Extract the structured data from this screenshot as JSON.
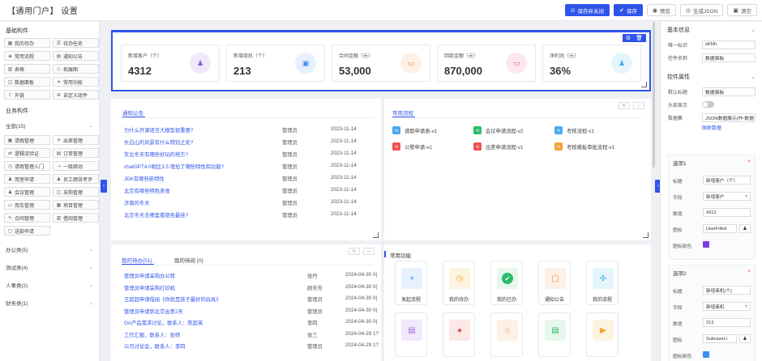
{
  "header": {
    "title": "【通用门户】 设置",
    "buttons": [
      {
        "label": "保存并关闭",
        "icon": "save-close-icon"
      },
      {
        "label": "保存",
        "icon": "save-icon"
      },
      {
        "label": "预览",
        "icon": "eye-icon"
      },
      {
        "label": "生成JSON",
        "icon": "code-icon"
      },
      {
        "label": "清空",
        "icon": "trash-icon"
      }
    ]
  },
  "left": {
    "basic_title": "基础构件",
    "basic": [
      "我的待办",
      "待办任务",
      "常用流程",
      "通知公告",
      "表格",
      "拓展图",
      "数据面板",
      "常用功能",
      "外链",
      "自定义组件"
    ],
    "biz_title": "业务构件",
    "biz_group": "全部(15)",
    "biz": [
      "请假管理",
      "出差管理",
      "逻辑流验证",
      "订单管理",
      "请假管理入门",
      "一级跳动",
      "用室申请",
      "员工绩效考评",
      "会议管理",
      "采购管理",
      "用车管理",
      "项目管理",
      "合同管理",
      "借阅管理",
      "送款申请"
    ],
    "categories": [
      "办公类(5)",
      "测试类(4)",
      "人事类(2)",
      "财务类(1)"
    ]
  },
  "stats": [
    {
      "label": "新增客户（个）",
      "value": "4312",
      "color": "#7b61d9",
      "bg": "#efe9fb",
      "icon": "user-icon"
    },
    {
      "label": "新增商机（个）",
      "value": "213",
      "color": "#3b8ff0",
      "bg": "#e6f1fd",
      "icon": "briefcase-icon"
    },
    {
      "label": "合同金额（元）",
      "value": "53,000",
      "color": "#f08a3b",
      "bg": "#fdf0e6",
      "icon": "folder-icon"
    },
    {
      "label": "回款金额（元）",
      "value": "870,000",
      "color": "#e8517a",
      "bg": "#fde8ee",
      "icon": "card-icon"
    },
    {
      "label": "净利润（元）",
      "value": "36%",
      "color": "#3bb4e8",
      "bg": "#e4f5fc",
      "icon": "person-icon"
    }
  ],
  "notice": {
    "tab": "通知公告",
    "rows": [
      {
        "title": "为什么开源语言大模型很重要?",
        "user": "管理员",
        "date": "2023-11-14"
      },
      {
        "title": "长白山的风景有什么特别之处?",
        "user": "管理员",
        "date": "2023-11-14"
      },
      {
        "title": "东北冬天有哪些好玩的地方?",
        "user": "管理员",
        "date": "2023-11-14"
      },
      {
        "title": "chatGPT4.0相比3.5 增加了哪些特性和功能?",
        "user": "管理员",
        "date": "2023-11-14"
      },
      {
        "title": "JDK有哪些新特性",
        "user": "管理员",
        "date": "2023-11-14"
      },
      {
        "title": "北京有哪些特色美食",
        "user": "管理员",
        "date": "2023-11-14"
      },
      {
        "title": "济南的冬天",
        "user": "管理员",
        "date": "2023-11-14"
      },
      {
        "title": "北京冬天去哪里看银杏最佳?",
        "user": "管理员",
        "date": "2023-11-14"
      }
    ]
  },
  "flows": {
    "tab": "常用流程",
    "items": [
      {
        "label": "请假申请表-v1",
        "color": "#4aa8f0",
        "icon": "share-icon"
      },
      {
        "label": "会议申请流程-v2",
        "color": "#2dbb6b",
        "icon": "share-icon"
      },
      {
        "label": "考核流程-v1",
        "color": "#4aa8f0",
        "icon": "share-icon"
      },
      {
        "label": "公警申请-v1",
        "color": "#f05050",
        "icon": "share-icon"
      },
      {
        "label": "出差申请流程-v1",
        "color": "#f05050",
        "icon": "share-icon"
      },
      {
        "label": "考核模板审批流程-v1",
        "color": "#f5a03a",
        "icon": "share-icon"
      }
    ]
  },
  "todo": {
    "tabs": [
      "我的待办(51)",
      "我的待阅 (0)"
    ],
    "rows": [
      {
        "title": "管理员申请采购办公转",
        "user": "张丹",
        "date": "2024-04-30 0("
      },
      {
        "title": "管理员申请采购打印机",
        "user": "顾芳芳",
        "date": "2024-04-30 0("
      },
      {
        "title": "王超超申请借阅《你就是孩子最好的玩具》",
        "user": "管理员",
        "date": "2024-04-30 0("
      },
      {
        "title": "管理员申请到北京出差2天",
        "user": "管理员",
        "date": "2024-04-30 0("
      },
      {
        "title": "OA产品需求讨论，联系人：陈超英",
        "user": "李四",
        "date": "2024-04-30 0("
      },
      {
        "title": "工作汇报，联系人：张师",
        "user": "张三",
        "date": "2024-04-29 1?"
      },
      {
        "title": "公司讨论会，联系人：李四",
        "user": "管理员",
        "date": "2024-04-29 1?"
      }
    ]
  },
  "functions": {
    "title": "常用功能",
    "items": [
      {
        "label": "发起流程",
        "icon": "plus-icon",
        "glyph": "+",
        "color": "#3b8ff0",
        "bg": "#e6f1fd"
      },
      {
        "label": "我的待办",
        "icon": "clock-icon",
        "glyph": "◷",
        "color": "#f5a623",
        "bg": "#fdf3e1"
      },
      {
        "label": "我的已办",
        "icon": "check-icon",
        "glyph": "✔",
        "color": "#fff",
        "bg": "#e7f7ec"
      },
      {
        "label": "通知公告",
        "icon": "notice-icon",
        "glyph": "▢",
        "color": "#f08a3b",
        "bg": "#fdf0e6"
      },
      {
        "label": "我的流程",
        "icon": "flow-icon",
        "glyph": "✣",
        "color": "#3bb4e8",
        "bg": "#e4f5fc"
      },
      {
        "label": "",
        "icon": "document-icon",
        "glyph": "▤",
        "color": "#9b6cdb",
        "bg": "#f1e9fb"
      },
      {
        "label": "",
        "icon": "user-icon",
        "glyph": "●",
        "color": "#e85050",
        "bg": "#fde8e8"
      },
      {
        "label": "",
        "icon": "home-icon",
        "glyph": "⌂",
        "color": "#f08a3b",
        "bg": "#fdf0e6"
      },
      {
        "label": "",
        "icon": "sheet-icon",
        "glyph": "▤",
        "color": "#2dbb6b",
        "bg": "#e7f7ec"
      },
      {
        "label": "",
        "icon": "play-icon",
        "glyph": "▶",
        "color": "#f5a623",
        "bg": "#fdf3e1"
      }
    ]
  },
  "props": {
    "basic_title": "基本信息",
    "id_label": "唯一标识",
    "id_value": "sKNh",
    "name_label": "控件名称",
    "name_value": "数据面板",
    "attr_title": "控件属性",
    "default_title_label": "默认标题",
    "default_title_value": "数据面板",
    "header_show_label": "头部显示",
    "dataset_label": "数据集",
    "dataset_value": "JSON数据展示(作-数据",
    "dataset_link": "图射数据",
    "options": [
      {
        "title": "选项1",
        "title_label": "标题",
        "title_value": "新增客户（个）",
        "field_label": "字段",
        "field_value": "新增客户",
        "value_label": "数值",
        "value": "4312",
        "icon_label": "图标",
        "icon_value": "UserFilled",
        "color_label": "图标颜色",
        "color": "#7b3fe4"
      },
      {
        "title": "选项2",
        "title_label": "标题",
        "title_value": "新增商机(个)",
        "field_label": "字段",
        "field_value": "新增商机",
        "value_label": "数值",
        "value": "213",
        "icon_label": "图标",
        "icon_value": "SuitcaseLi",
        "color_label": "图标颜色",
        "color": "#3b8ff0"
      }
    ]
  }
}
